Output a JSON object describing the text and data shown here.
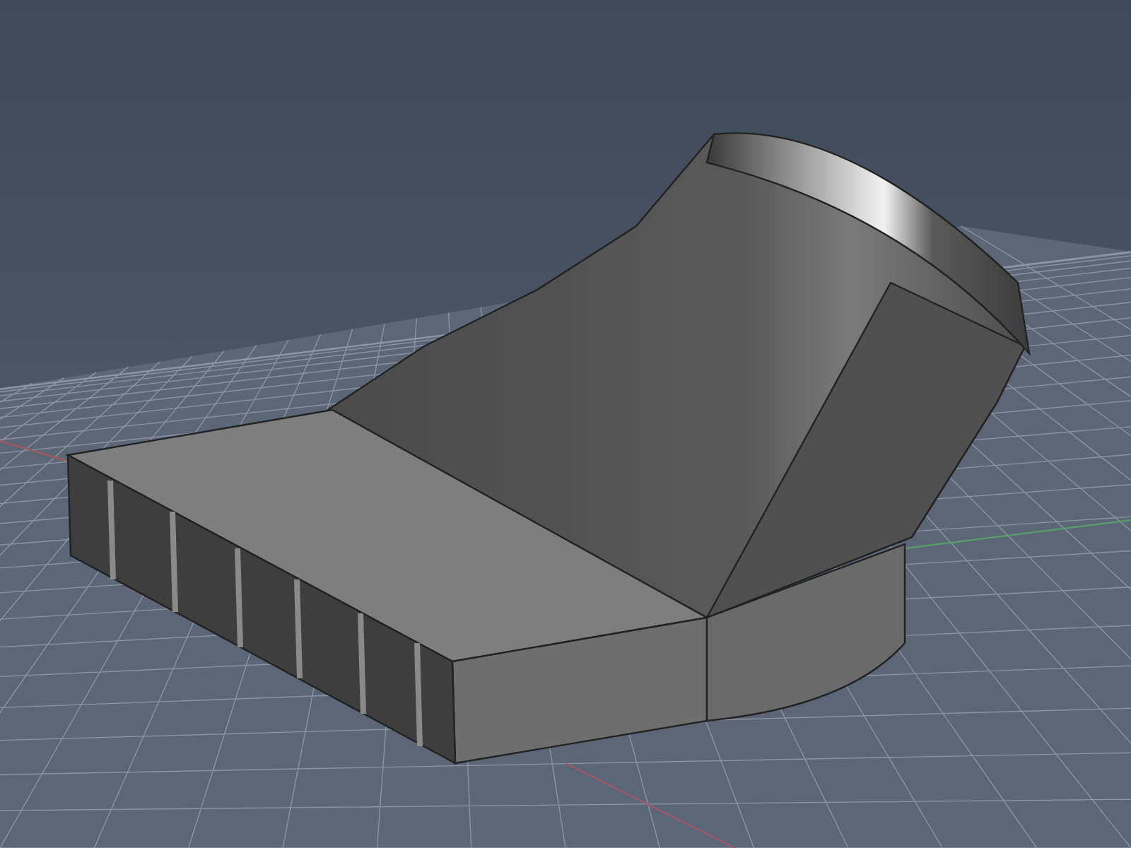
{
  "viewport": {
    "grid_visible": true
  }
}
